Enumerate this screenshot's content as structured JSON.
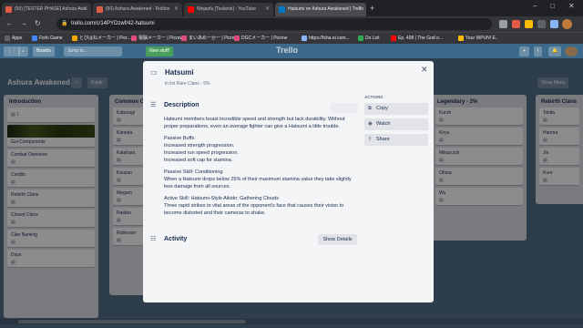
{
  "browser": {
    "tabs": [
      {
        "label": "(50) [TESTER PHASE] Ashura Awa",
        "fav_color": "#e25b45"
      },
      {
        "label": "(50) Ashura Awakened - Roblox",
        "fav_color": "#e25b45"
      },
      {
        "label": "Ninjaofu [Teslanio] - YouTube",
        "fav_color": "#ff0000"
      },
      {
        "label": "Hatsumi on Ashura Awakened | Trello",
        "fav_color": "#0079bf"
      }
    ],
    "url": "trello.com/c/14PYDzwf/42-hatsumi",
    "bookmarks": [
      {
        "label": "Apps",
        "color": "#5f6368"
      },
      {
        "label": "Fishi Game",
        "color": "#4285f4"
      },
      {
        "label": "とびはねメーカー | Picr...",
        "color": "#f4a300"
      },
      {
        "label": "電脳メーカー | Picrew",
        "color": "#e04b7c"
      },
      {
        "label": "まいあめーかー | Picrew",
        "color": "#e04b7c"
      },
      {
        "label": "DGCメーカー | Picrew",
        "color": "#e04b7c"
      },
      {
        "label": "https://fsha.ei.com...",
        "color": "#8ab4f8"
      },
      {
        "label": "Do List",
        "color": "#34a853"
      },
      {
        "label": "Ep. 498 | The God o...",
        "color": "#ff0000"
      },
      {
        "label": "Your WPUN! E..",
        "color": "#fbbc04"
      }
    ]
  },
  "trello_header": {
    "boards_label": "Boards",
    "jump_placeholder": "Jump to...",
    "new_stuff_label": "New stuff!",
    "logo": "Trello"
  },
  "board": {
    "title": "Ashura Awakened",
    "visibility_label": "Public",
    "show_menu_label": "Show Menu",
    "lists": [
      {
        "title": "Introduction",
        "cards": [
          "",
          "Gui Components",
          "Combat Overview",
          "Credits",
          "Rebirth Clans",
          "Closed Clans",
          "Clan Naming",
          "Days"
        ]
      },
      {
        "title": "Common Clans",
        "cards": [
          "Kaburagi",
          "Kaneda",
          "Katahara",
          "Kouzan",
          "Meguro",
          "Raiden",
          "Robinson"
        ]
      },
      {
        "title": "Legendary - 2%",
        "cards": [
          "Kuroh",
          "Kiryu",
          "Mikazuchi",
          "Ohma",
          "Wu"
        ]
      },
      {
        "title": "Rebirth Clans",
        "cards": [
          "Tokita",
          "Hanma",
          "Jin",
          "Kure"
        ]
      }
    ]
  },
  "modal": {
    "title": "Hatsumi",
    "in_list": "in list Rare Clans - 5%",
    "description_heading": "Description",
    "description": [
      "Hatsumi members boast incredible speed and strength but lack durability. Without proper preparations, even an average fighter can give a Hatsumi a little trouble.",
      "Passive Buffs:\nIncreased strength progression.\nIncreased run speed progression.\nIncreased soft cap for stamina.",
      "Passive Skill: Conditioning\nWhen a Hatsumi drops below 25% of their maximum stamina value they take slightly less damage from all sources.",
      "Active Skill: Hatsumi-Style Aikido: Gathering Clouds\nThree rapid strikes to vital areas of the opponent's face that causes their vision to become distorted and their cameras to shake."
    ],
    "activity_heading": "Activity",
    "show_details_label": "Show Details",
    "actions_label": "ACTIONS",
    "actions": [
      "Copy",
      "Watch",
      "Share"
    ]
  }
}
